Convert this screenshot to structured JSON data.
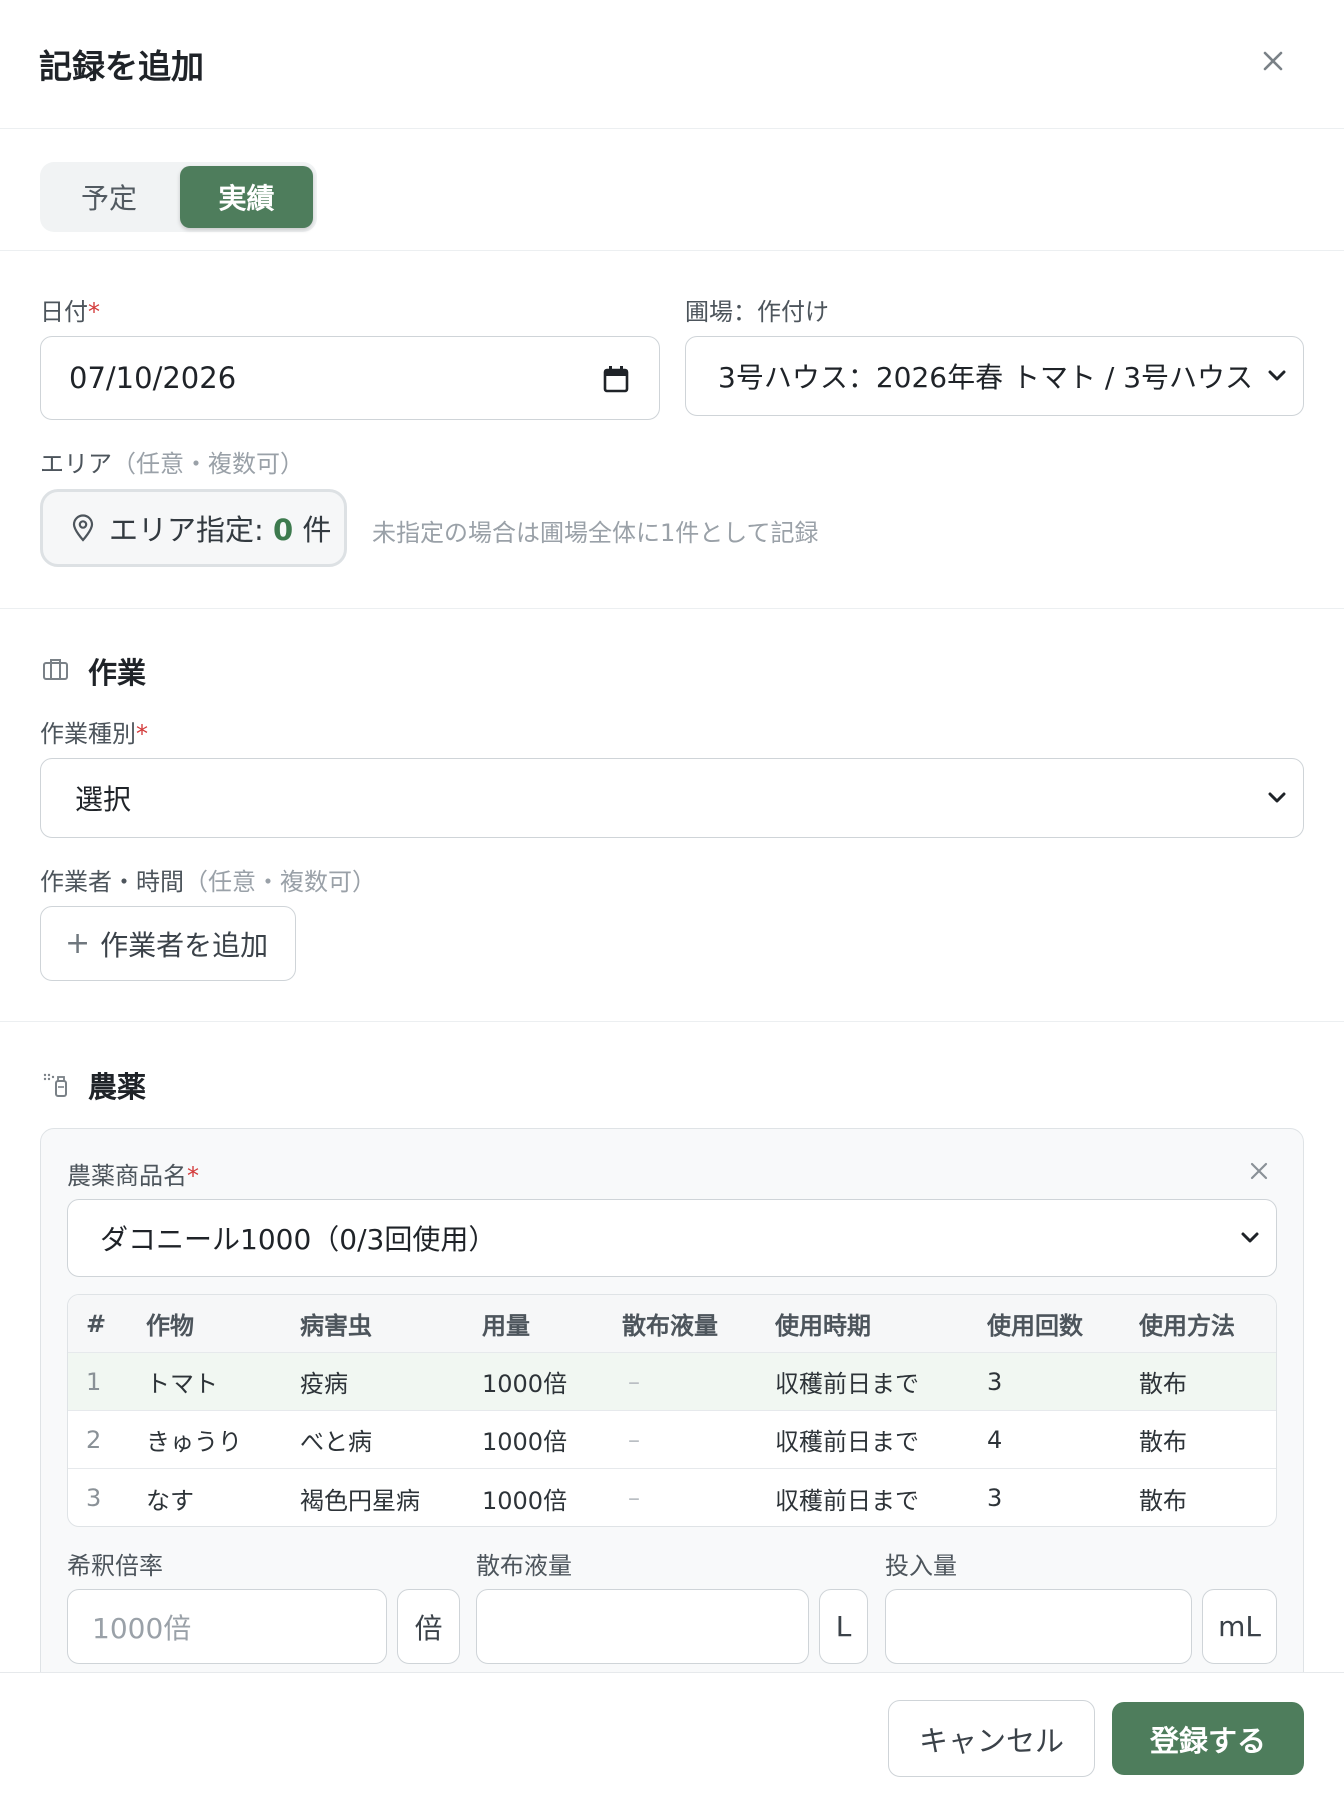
{
  "modal": {
    "title": "記録を追加"
  },
  "mode_toggle": {
    "planned": "予定",
    "actual": "実績",
    "selected": "実績"
  },
  "date": {
    "label": "日付",
    "required": "*",
    "value": "07/10/2026"
  },
  "field_crop": {
    "label": "圃場：作付け",
    "value": "3号ハウス：2026年春 トマト / 3号ハウス"
  },
  "area": {
    "label": "エリア",
    "hint": "（任意・複数可）",
    "button_prefix": "エリア指定: ",
    "count": "0",
    "unit": " 件",
    "note": "未指定の場合は圃場全体に1件として記録"
  },
  "work": {
    "title": "作業",
    "type_label": "作業種別",
    "required": "*",
    "type_value": "選択",
    "workers_label": "作業者・時間",
    "workers_hint": "（任意・複数可）",
    "add_worker": "作業者を追加"
  },
  "pesticide": {
    "title": "農薬",
    "product_label": "農薬商品名",
    "required": "*",
    "product_value": "ダコニール1000（0/3回使用）",
    "table": {
      "headers": [
        "#",
        "作物",
        "病害虫",
        "用量",
        "散布液量",
        "使用時期",
        "使用回数",
        "使用方法"
      ],
      "rows": [
        [
          "1",
          "トマト",
          "疫病",
          "1000倍",
          "–",
          "収穫前日まで",
          "3",
          "散布"
        ],
        [
          "2",
          "きゅうり",
          "べと病",
          "1000倍",
          "–",
          "収穫前日まで",
          "4",
          "散布"
        ],
        [
          "3",
          "なす",
          "褐色円星病",
          "1000倍",
          "–",
          "収穫前日まで",
          "3",
          "散布"
        ]
      ]
    },
    "dilution": {
      "label": "希釈倍率",
      "placeholder": "1000倍",
      "unit": "倍"
    },
    "spray_volume": {
      "label": "散布液量",
      "unit": "L"
    },
    "input_amount": {
      "label": "投入量",
      "unit": "mL"
    }
  },
  "footer": {
    "cancel": "キャンセル",
    "submit": "登録する"
  },
  "colors": {
    "accent": "#4e7d5c",
    "required": "#d33a3a",
    "count": "#3d7a4e"
  }
}
